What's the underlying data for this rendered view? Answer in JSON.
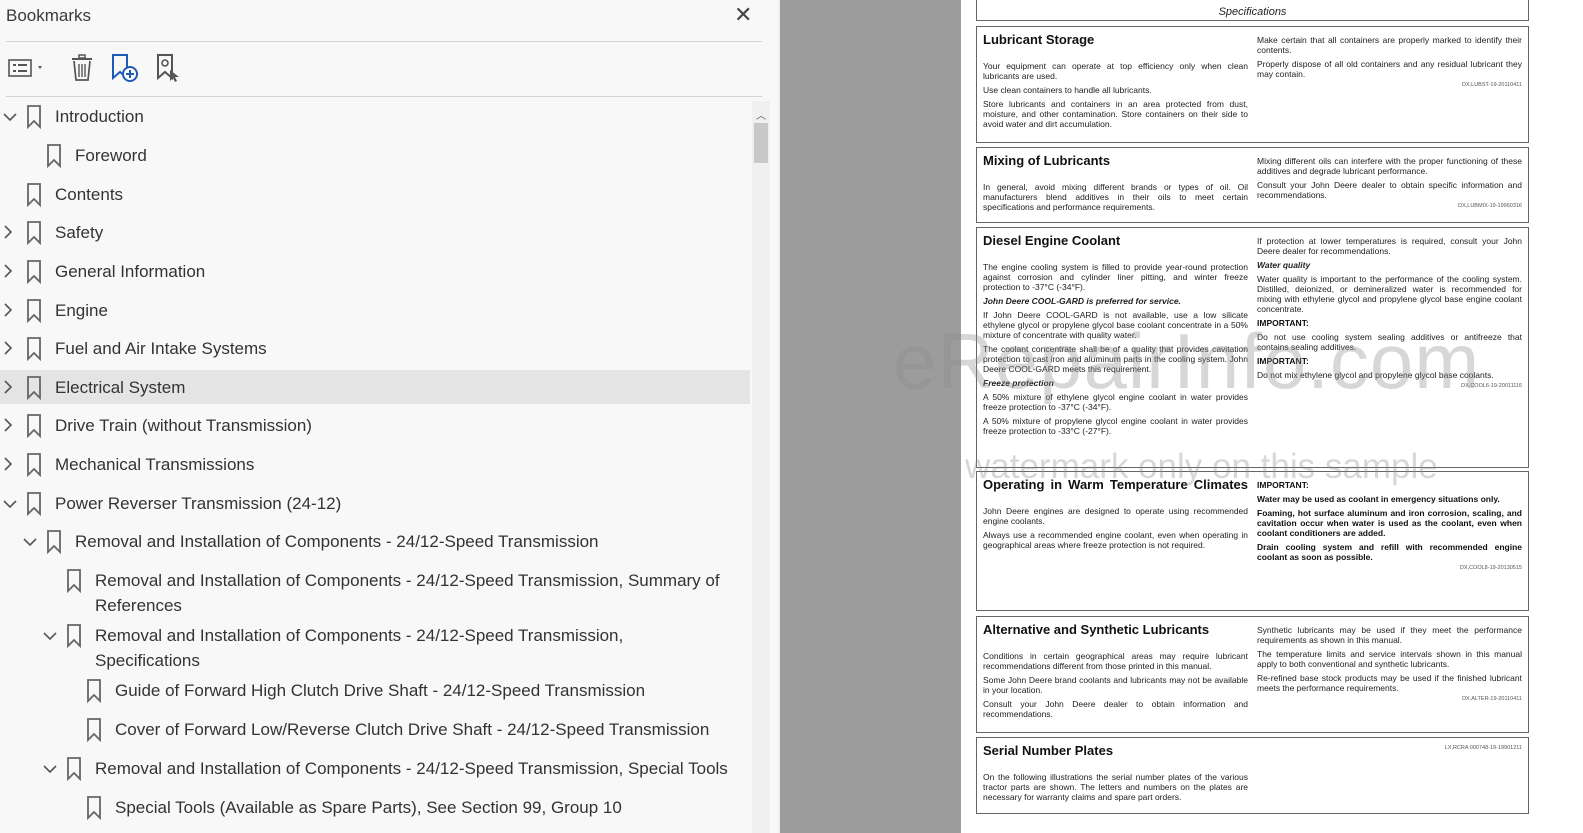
{
  "bookmarks": {
    "title": "Bookmarks",
    "close_icon": "close-icon",
    "toolbar": {
      "options_icon": "bookmark-options-icon",
      "delete_icon": "trash-icon",
      "add_icon": "add-bookmark-icon",
      "find_icon": "find-current-bookmark-icon"
    },
    "items": [
      {
        "label": "Introduction",
        "expand": "down"
      },
      {
        "label": "Foreword",
        "expand": "none"
      },
      {
        "label": "Contents",
        "expand": "none"
      },
      {
        "label": "Safety",
        "expand": "right"
      },
      {
        "label": "General Information",
        "expand": "right"
      },
      {
        "label": "Engine",
        "expand": "right"
      },
      {
        "label": "Fuel and Air Intake Systems",
        "expand": "right"
      },
      {
        "label": "Electrical System",
        "expand": "right",
        "selected": true
      },
      {
        "label": "Drive Train (without Transmission)",
        "expand": "right"
      },
      {
        "label": "Mechanical Transmissions",
        "expand": "right"
      },
      {
        "label": "Power Reverser Transmission (24-12)",
        "expand": "down"
      },
      {
        "label": "Removal and Installation of Components - 24/12-Speed Transmission",
        "expand": "down"
      },
      {
        "label": "Removal and Installation of Components - 24/12-Speed Transmission, Summary of",
        "label2": "References",
        "expand": "none"
      },
      {
        "label": "Removal and Installation of Components - 24/12-Speed Transmission,",
        "label2": "Specifications",
        "expand": "down"
      },
      {
        "label": "Guide of Forward High Clutch Drive Shaft - 24/12-Speed Transmission",
        "expand": "none"
      },
      {
        "label": "Cover of Forward Low/Reverse Clutch Drive Shaft - 24/12-Speed Transmission",
        "expand": "none"
      },
      {
        "label": "Removal and Installation of Components - 24/12-Speed Transmission, Special Tools",
        "expand": "down"
      },
      {
        "label": "Special Tools (Available as Spare Parts), See Section 99, Group 10",
        "expand": "none"
      }
    ]
  },
  "document": {
    "header": "Specifications",
    "watermark1": "eRepairInfo.com",
    "watermark2": "watermark only on this sample",
    "sections": [
      {
        "title": "Lubricant Storage",
        "left": [
          "Your equipment can operate at top efficiency only when clean lubricants are used.",
          "Use clean containers to handle all lubricants.",
          "Store lubricants and containers in an area protected from dust, moisture, and other contamination. Store containers on their side to avoid water and dirt accumulation."
        ],
        "right": [
          "Make certain that all containers are properly marked to identify their contents.",
          "Properly dispose of all old containers and any residual lubricant they may contain."
        ],
        "code": "DX,LUBST-19-20110411"
      },
      {
        "title": "Mixing of Lubricants",
        "left": [
          "In general, avoid mixing different brands or types of oil. Oil manufacturers blend additives in their oils to meet certain specifications and performance requirements."
        ],
        "right": [
          "Mixing different oils can interfere with the proper functioning of these additives and degrade lubricant performance.",
          "Consult your John Deere dealer to obtain specific information and recommendations."
        ],
        "code": "DX,LUBMIX-19-19960316"
      },
      {
        "title": "Diesel Engine Coolant",
        "left": [
          "The engine cooling system is filled to provide year-round protection against corrosion and cylinder liner pitting, and winter freeze protection to -37°C (-34°F).",
          "John Deere COOL-GARD is preferred for service.",
          "If John Deere COOL-GARD is not available, use a low silicate ethylene glycol or propylene glycol base coolant concentrate in a 50% mixture of concentrate with quality water.",
          "The coolant concentrate shall be of a quality that provides cavitation protection to cast iron and aluminum parts in the cooling system. John Deere COOL-GARD meets this requirement.",
          "Freeze protection",
          "A 50% mixture of ethylene glycol engine coolant in water provides freeze protection to -37°C (-34°F).",
          "A 50% mixture of propylene glycol engine coolant in water provides freeze protection to -33°C (-27°F)."
        ],
        "right": [
          "If protection at lower temperatures is required, consult your John Deere dealer for recommendations.",
          "Water quality",
          "Water quality is important to the performance of the cooling system. Distilled, deionized, or demineralized water is recommended for mixing with ethylene glycol and propylene glycol base engine coolant concentrate.",
          "IMPORTANT:",
          "Do not use cooling system sealing additives or antifreeze that contains sealing additives.",
          "IMPORTANT:",
          "Do not mix ethylene glycol and propylene glycol base coolants."
        ],
        "code": "DX,COOL6-19-20011116"
      },
      {
        "title": "Operating in Warm Temperature Climates",
        "left": [
          "John Deere engines are designed to operate using recommended engine coolants.",
          "Always use a recommended engine coolant, even when operating in geographical areas where freeze protection is not required."
        ],
        "right": [
          "IMPORTANT:",
          "Water may be used as coolant in emergency situations only.",
          "Foaming, hot surface aluminum and iron corrosion, scaling, and cavitation occur when water is used as the coolant, even when coolant conditioners are added.",
          "Drain cooling system and refill with recommended engine coolant as soon as possible."
        ],
        "code": "DX,COOL8-19-20130515"
      },
      {
        "title": "Alternative and Synthetic Lubricants",
        "left": [
          "Conditions in certain geographical areas may require lubricant recommendations different from those printed in this manual.",
          "Some John Deere brand coolants and lubricants may not be available in your location.",
          "Consult your John Deere dealer to obtain information and recommendations."
        ],
        "right": [
          "Synthetic lubricants may be used if they meet the performance requirements as shown in this manual.",
          "The temperature limits and service intervals shown in this manual apply to both conventional and synthetic lubricants.",
          "Re-refined base stock products may be used if the finished lubricant meets the performance requirements."
        ],
        "code": "DX,ALTER-19-20110411"
      },
      {
        "title": "Serial Number Plates",
        "left": [
          "On the following illustrations the serial number plates of the various tractor parts are shown. The letters and numbers on the plates are necessary for warranty claims and spare part orders."
        ],
        "right": [],
        "code": "LX,RCRA 000748-19-19901211"
      }
    ]
  }
}
